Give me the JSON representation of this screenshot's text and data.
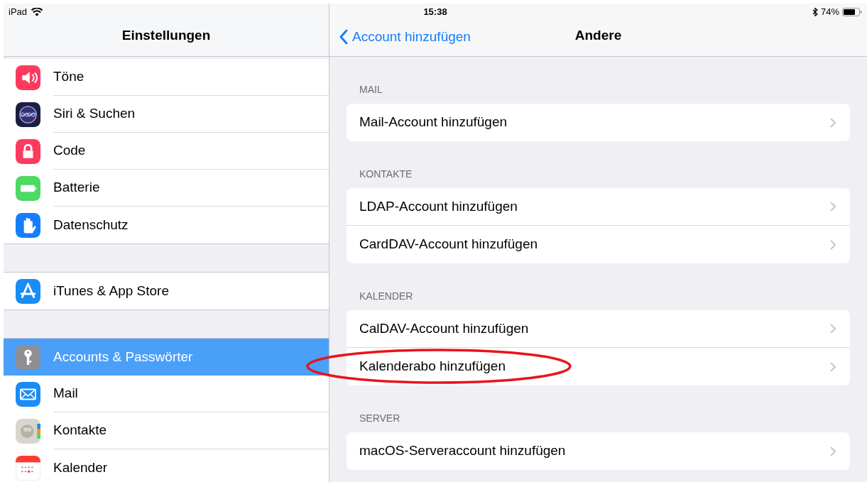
{
  "status_bar": {
    "device": "iPad",
    "time": "15:38",
    "battery": "74%"
  },
  "sidebar": {
    "title": "Einstellungen",
    "groups": [
      {
        "items": [
          {
            "label": "Töne",
            "selected": false
          },
          {
            "label": "Siri & Suchen",
            "selected": false
          },
          {
            "label": "Code",
            "selected": false
          },
          {
            "label": "Batterie",
            "selected": false
          },
          {
            "label": "Datenschutz",
            "selected": false
          }
        ]
      },
      {
        "items": [
          {
            "label": "iTunes & App Store",
            "selected": false
          }
        ]
      },
      {
        "items": [
          {
            "label": "Accounts & Passwörter",
            "selected": true
          },
          {
            "label": "Mail",
            "selected": false
          },
          {
            "label": "Kontakte",
            "selected": false
          },
          {
            "label": "Kalender",
            "selected": false
          }
        ]
      }
    ]
  },
  "detail": {
    "back": "Account hinzufügen",
    "title": "Andere",
    "sections": [
      {
        "header": "MAIL",
        "rows": [
          {
            "label": "Mail-Account hinzufügen",
            "highlighted": false
          }
        ]
      },
      {
        "header": "KONTAKTE",
        "rows": [
          {
            "label": "LDAP-Account hinzufügen",
            "highlighted": false
          },
          {
            "label": "CardDAV-Account hinzufügen",
            "highlighted": false
          }
        ]
      },
      {
        "header": "KALENDER",
        "rows": [
          {
            "label": "CalDAV-Account hinzufügen",
            "highlighted": false
          },
          {
            "label": "Kalenderabo hinzufügen",
            "highlighted": true
          }
        ]
      },
      {
        "header": "SERVER",
        "rows": [
          {
            "label": "macOS-Serveraccount hinzufügen",
            "highlighted": false
          }
        ]
      }
    ]
  }
}
